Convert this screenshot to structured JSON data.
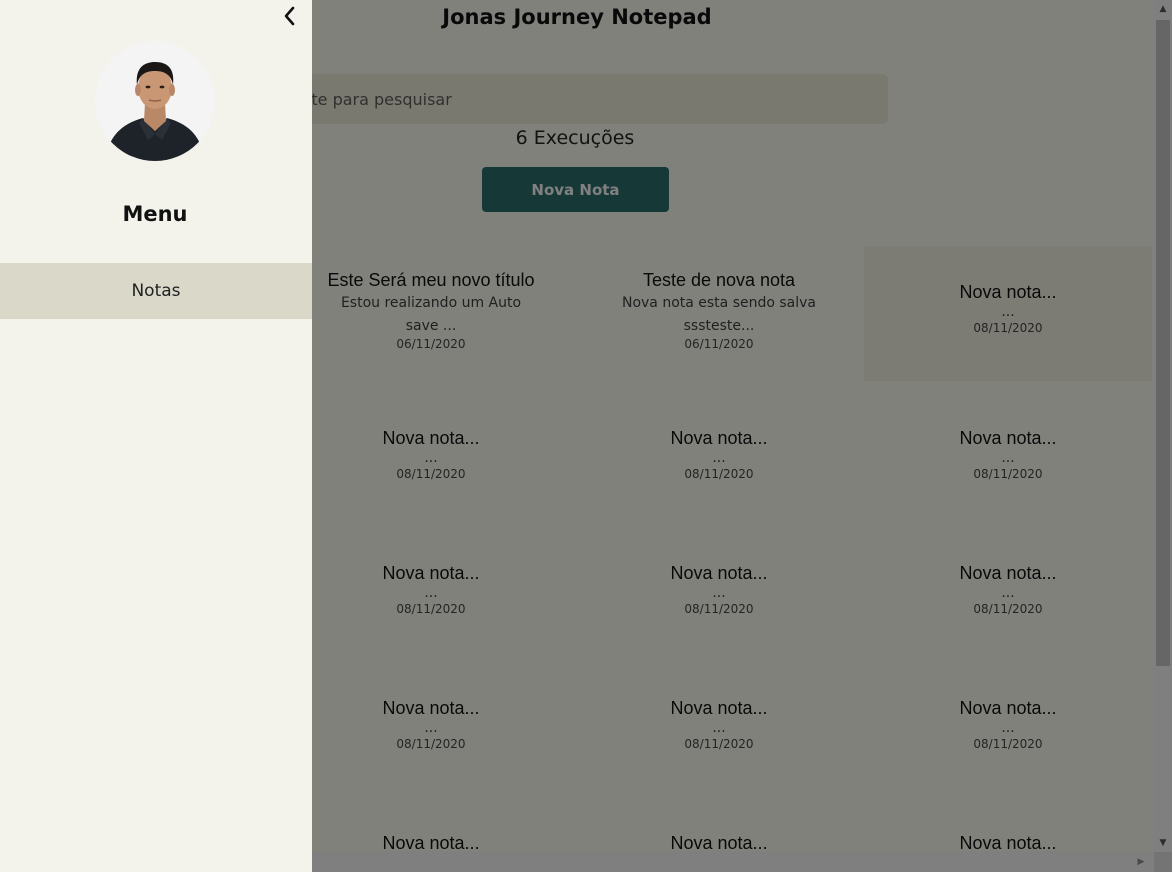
{
  "app": {
    "title": "Jonas Journey Notepad"
  },
  "search": {
    "placeholder": "Digite para pesquisar"
  },
  "counter": {
    "text": "6 Execuções"
  },
  "actions": {
    "new_note_label": "Nova Nota"
  },
  "notes": [
    {
      "title": "Este Será meu novo título",
      "desc_line1": "Estou realizando um Auto",
      "desc_line2": "save ...",
      "date": "06/11/2020"
    },
    {
      "title": "Teste de nova nota",
      "desc_line1": "Nova nota esta sendo salva",
      "desc_line2": "sssteste...",
      "date": "06/11/2020"
    },
    {
      "title": "Nova nota...",
      "desc_line1": "...",
      "desc_line2": "",
      "date": "08/11/2020"
    },
    {
      "title": "Nova nota...",
      "desc_line1": "...",
      "desc_line2": "",
      "date": "08/11/2020"
    },
    {
      "title": "Nova nota...",
      "desc_line1": "...",
      "desc_line2": "",
      "date": "08/11/2020"
    },
    {
      "title": "Nova nota...",
      "desc_line1": "...",
      "desc_line2": "",
      "date": "08/11/2020"
    },
    {
      "title": "Nova nota...",
      "desc_line1": "...",
      "desc_line2": "",
      "date": "08/11/2020"
    },
    {
      "title": "Nova nota...",
      "desc_line1": "...",
      "desc_line2": "",
      "date": "08/11/2020"
    },
    {
      "title": "Nova nota...",
      "desc_line1": "...",
      "desc_line2": "",
      "date": "08/11/2020"
    },
    {
      "title": "Nova nota...",
      "desc_line1": "...",
      "desc_line2": "",
      "date": "08/11/2020"
    },
    {
      "title": "Nova nota...",
      "desc_line1": "...",
      "desc_line2": "",
      "date": "08/11/2020"
    },
    {
      "title": "Nova nota...",
      "desc_line1": "...",
      "desc_line2": "",
      "date": "08/11/2020"
    },
    {
      "title": "Nova nota...",
      "desc_line1": "",
      "desc_line2": "",
      "date": ""
    },
    {
      "title": "Nova nota...",
      "desc_line1": "",
      "desc_line2": "",
      "date": ""
    },
    {
      "title": "Nova nota...",
      "desc_line1": "",
      "desc_line2": "",
      "date": ""
    }
  ],
  "drawer": {
    "menu_title": "Menu",
    "items": [
      {
        "label": "Notas",
        "active": true
      }
    ],
    "back_icon": "chevron-left-icon",
    "avatar_icon": "user-photo"
  },
  "colors": {
    "accent": "#2a6c69",
    "background": "#f3f3eb",
    "search_bg": "#e6e4d2",
    "menu_active": "#d9d8c9"
  }
}
